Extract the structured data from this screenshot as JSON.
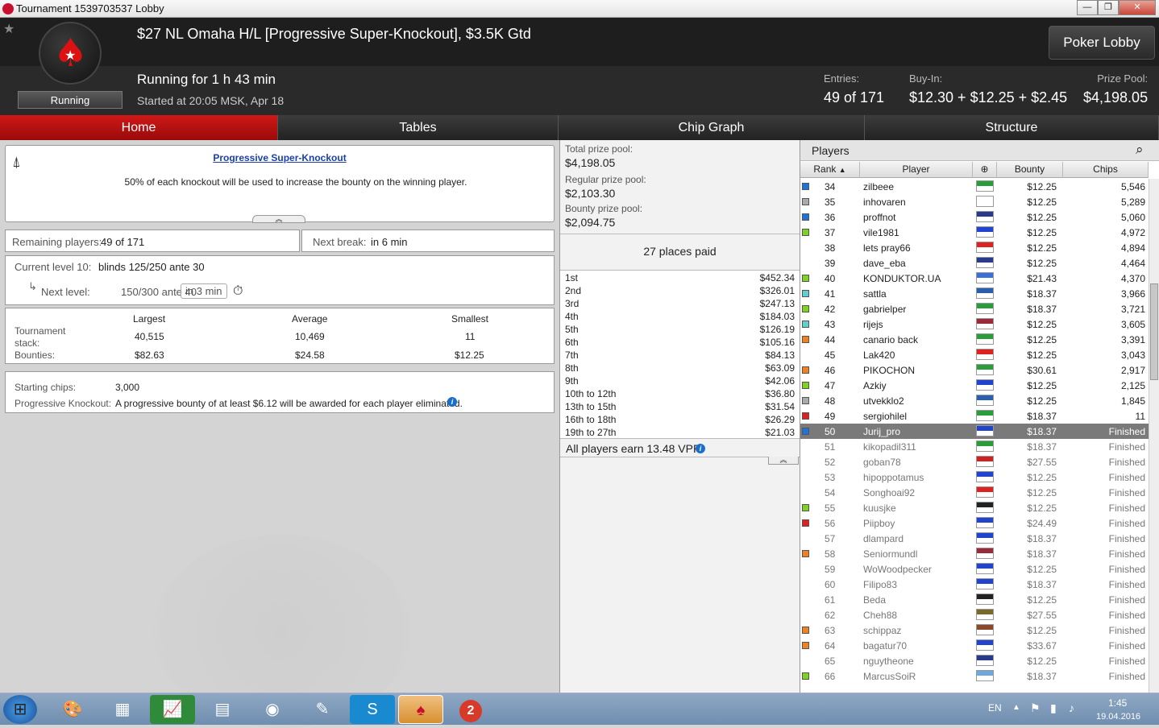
{
  "window": {
    "title": "Tournament 1539703537 Lobby",
    "min": "—",
    "max": "❐",
    "close": "✕"
  },
  "header": {
    "title": "$27 NL Omaha H/L [Progressive Super-Knockout], $3.5K Gtd",
    "running": "Running for 1 h 43 min",
    "started": "Started at 20:05 MSK, Apr 18",
    "status_badge": "Running",
    "lobby_button": "Poker Lobby",
    "entries_label": "Entries:",
    "entries_value": "49 of 171",
    "buyin_label": "Buy-In:",
    "buyin_value": "$12.30 + $12.25 + $2.45",
    "prizepool_label": "Prize Pool:",
    "prizepool_value": "$4,198.05"
  },
  "tabs": [
    "Home",
    "Tables",
    "Chip Graph",
    "Structure"
  ],
  "home": {
    "pko_title": "Progressive Super-Knockout",
    "pko_text": "50% of each knockout will be used to increase the bounty on the winning player.",
    "remaining_label": "Remaining players:",
    "remaining_value": "49 of 171",
    "next_break_label": "Next break:",
    "next_break_value": "in 6 min",
    "current_level_label": "Current level 10:",
    "current_level_value": "blinds 125/250 ante 30",
    "next_level_label": "Next level:",
    "next_level_value": "150/300 ante 40",
    "next_level_time": "in 3 min",
    "stats_headers": [
      "Largest",
      "Average",
      "Smallest"
    ],
    "stack_label": "Tournament stack:",
    "stack_values": [
      "40,515",
      "10,469",
      "11"
    ],
    "bounties_label": "Bounties:",
    "bounty_values": [
      "$82.63",
      "$24.58",
      "$12.25"
    ],
    "starting_chips_label": "Starting chips:",
    "starting_chips_value": "3,000",
    "pk_label": "Progressive Knockout:",
    "pk_text": "A progressive bounty of at least $6.12 will be awarded for each player eliminated."
  },
  "prize": {
    "total_label": "Total prize pool:",
    "total_value": "$4,198.05",
    "regular_label": "Regular prize pool:",
    "regular_value": "$2,103.30",
    "bounty_label": "Bounty prize pool:",
    "bounty_value": "$2,094.75",
    "places_paid": "27 places paid",
    "places": [
      [
        "1st",
        "$452.34"
      ],
      [
        "2nd",
        "$326.01"
      ],
      [
        "3rd",
        "$247.13"
      ],
      [
        "4th",
        "$184.03"
      ],
      [
        "5th",
        "$126.19"
      ],
      [
        "6th",
        "$105.16"
      ],
      [
        "7th",
        "$84.13"
      ],
      [
        "8th",
        "$63.09"
      ],
      [
        "9th",
        "$42.06"
      ],
      [
        "10th to 12th",
        "$36.80"
      ],
      [
        "13th to 15th",
        "$31.54"
      ],
      [
        "16th to 18th",
        "$26.29"
      ],
      [
        "19th to 27th",
        "$21.03"
      ]
    ],
    "vpp": "All players earn 13.48 VPP."
  },
  "players": {
    "title": "Players",
    "columns": [
      "Rank",
      "Player",
      "Bounty",
      "Chips"
    ],
    "rows": [
      {
        "rank": "34",
        "name": "zilbeee",
        "bounty": "$12.25",
        "chips": "5,546",
        "sq": "#1e73d8",
        "flag": "#2a9d3a"
      },
      {
        "rank": "35",
        "name": "inhovaren",
        "bounty": "$12.25",
        "chips": "5,289",
        "sq": "#aaaaaa",
        "flag": "#ffffff"
      },
      {
        "rank": "36",
        "name": "proffnot",
        "bounty": "$12.25",
        "chips": "5,060",
        "sq": "#1e73d8",
        "flag": "#2a3a8a"
      },
      {
        "rank": "37",
        "name": "vile1981",
        "bounty": "$12.25",
        "chips": "4,972",
        "sq": "#7ed321",
        "flag": "#2244cc"
      },
      {
        "rank": "38",
        "name": "lets pray66",
        "bounty": "$12.25",
        "chips": "4,894",
        "sq": "",
        "flag": "#dd2222"
      },
      {
        "rank": "39",
        "name": "dave_eba",
        "bounty": "$12.25",
        "chips": "4,464",
        "sq": "",
        "flag": "#2a3a8a"
      },
      {
        "rank": "40",
        "name": "KONDUKTOR.UA",
        "bounty": "$21.43",
        "chips": "4,370",
        "sq": "#7ed321",
        "flag": "#3a6fd8"
      },
      {
        "rank": "41",
        "name": "sattla",
        "bounty": "$18.37",
        "chips": "3,966",
        "sq": "#5fd0d0",
        "flag": "#2a5fb0"
      },
      {
        "rank": "42",
        "name": "gabrielper",
        "bounty": "$18.37",
        "chips": "3,721",
        "sq": "#7ed321",
        "flag": "#2a9d3a"
      },
      {
        "rank": "43",
        "name": "rijejs",
        "bounty": "$12.25",
        "chips": "3,605",
        "sq": "#5fd0d0",
        "flag": "#9a2a3a"
      },
      {
        "rank": "44",
        "name": "canario back",
        "bounty": "$12.25",
        "chips": "3,391",
        "sq": "#f08020",
        "flag": "#2a9d3a"
      },
      {
        "rank": "45",
        "name": "Lak420",
        "bounty": "$12.25",
        "chips": "3,043",
        "sq": "",
        "flag": "#dd2222"
      },
      {
        "rank": "46",
        "name": "PIKOCHON",
        "bounty": "$30.61",
        "chips": "2,917",
        "sq": "#f08020",
        "flag": "#2a9d3a"
      },
      {
        "rank": "47",
        "name": "Azkiy",
        "bounty": "$12.25",
        "chips": "2,125",
        "sq": "#7ed321",
        "flag": "#2244cc"
      },
      {
        "rank": "48",
        "name": "utvekklo2",
        "bounty": "$12.25",
        "chips": "1,845",
        "sq": "#aaaaaa",
        "flag": "#2a5fb0"
      },
      {
        "rank": "49",
        "name": "sergiohilel",
        "bounty": "$18.37",
        "chips": "11",
        "sq": "#e02020",
        "flag": "#2a9d3a"
      },
      {
        "rank": "50",
        "name": "Jurij_pro",
        "bounty": "$18.37",
        "chips": "Finished",
        "sq": "#1e73d8",
        "flag": "#2244cc",
        "selected": true
      },
      {
        "rank": "51",
        "name": "kikopadil311",
        "bounty": "$18.37",
        "chips": "Finished",
        "sq": "",
        "flag": "#2a9d3a"
      },
      {
        "rank": "52",
        "name": "goban78",
        "bounty": "$27.55",
        "chips": "Finished",
        "sq": "",
        "flag": "#cc2222"
      },
      {
        "rank": "53",
        "name": "hipoppotamus",
        "bounty": "$12.25",
        "chips": "Finished",
        "sq": "",
        "flag": "#2244cc"
      },
      {
        "rank": "54",
        "name": "Songhoai92",
        "bounty": "$12.25",
        "chips": "Finished",
        "sq": "",
        "flag": "#dd2222"
      },
      {
        "rank": "55",
        "name": "kuusjke",
        "bounty": "$12.25",
        "chips": "Finished",
        "sq": "#7ed321",
        "flag": "#222222"
      },
      {
        "rank": "56",
        "name": "Piipboy",
        "bounty": "$24.49",
        "chips": "Finished",
        "sq": "#e02020",
        "flag": "#2244cc"
      },
      {
        "rank": "57",
        "name": "dlampard",
        "bounty": "$18.37",
        "chips": "Finished",
        "sq": "",
        "flag": "#2244cc"
      },
      {
        "rank": "58",
        "name": "Seniormundl",
        "bounty": "$18.37",
        "chips": "Finished",
        "sq": "#f08020",
        "flag": "#9a2a3a"
      },
      {
        "rank": "59",
        "name": "WoWoodpecker",
        "bounty": "$12.25",
        "chips": "Finished",
        "sq": "",
        "flag": "#2244cc"
      },
      {
        "rank": "60",
        "name": "Filipo83",
        "bounty": "$18.37",
        "chips": "Finished",
        "sq": "",
        "flag": "#2244cc"
      },
      {
        "rank": "61",
        "name": "Beda",
        "bounty": "$12.25",
        "chips": "Finished",
        "sq": "",
        "flag": "#222222"
      },
      {
        "rank": "62",
        "name": "Cheh88",
        "bounty": "$27.55",
        "chips": "Finished",
        "sq": "",
        "flag": "#7a6a2a"
      },
      {
        "rank": "63",
        "name": "schippaz",
        "bounty": "$12.25",
        "chips": "Finished",
        "sq": "#f08020",
        "flag": "#8a4a2a"
      },
      {
        "rank": "64",
        "name": "bagatur70",
        "bounty": "$33.67",
        "chips": "Finished",
        "sq": "#f08020",
        "flag": "#2244cc"
      },
      {
        "rank": "65",
        "name": "nguytheone",
        "bounty": "$12.25",
        "chips": "Finished",
        "sq": "",
        "flag": "#2a3a8a"
      },
      {
        "rank": "66",
        "name": "MarcusSoiR",
        "bounty": "$18.37",
        "chips": "Finished",
        "sq": "#7ed321",
        "flag": "#6fa8dc"
      }
    ]
  },
  "taskbar": {
    "lang": "EN",
    "time": "1:45",
    "date": "19.04.2016",
    "badge": "2"
  }
}
